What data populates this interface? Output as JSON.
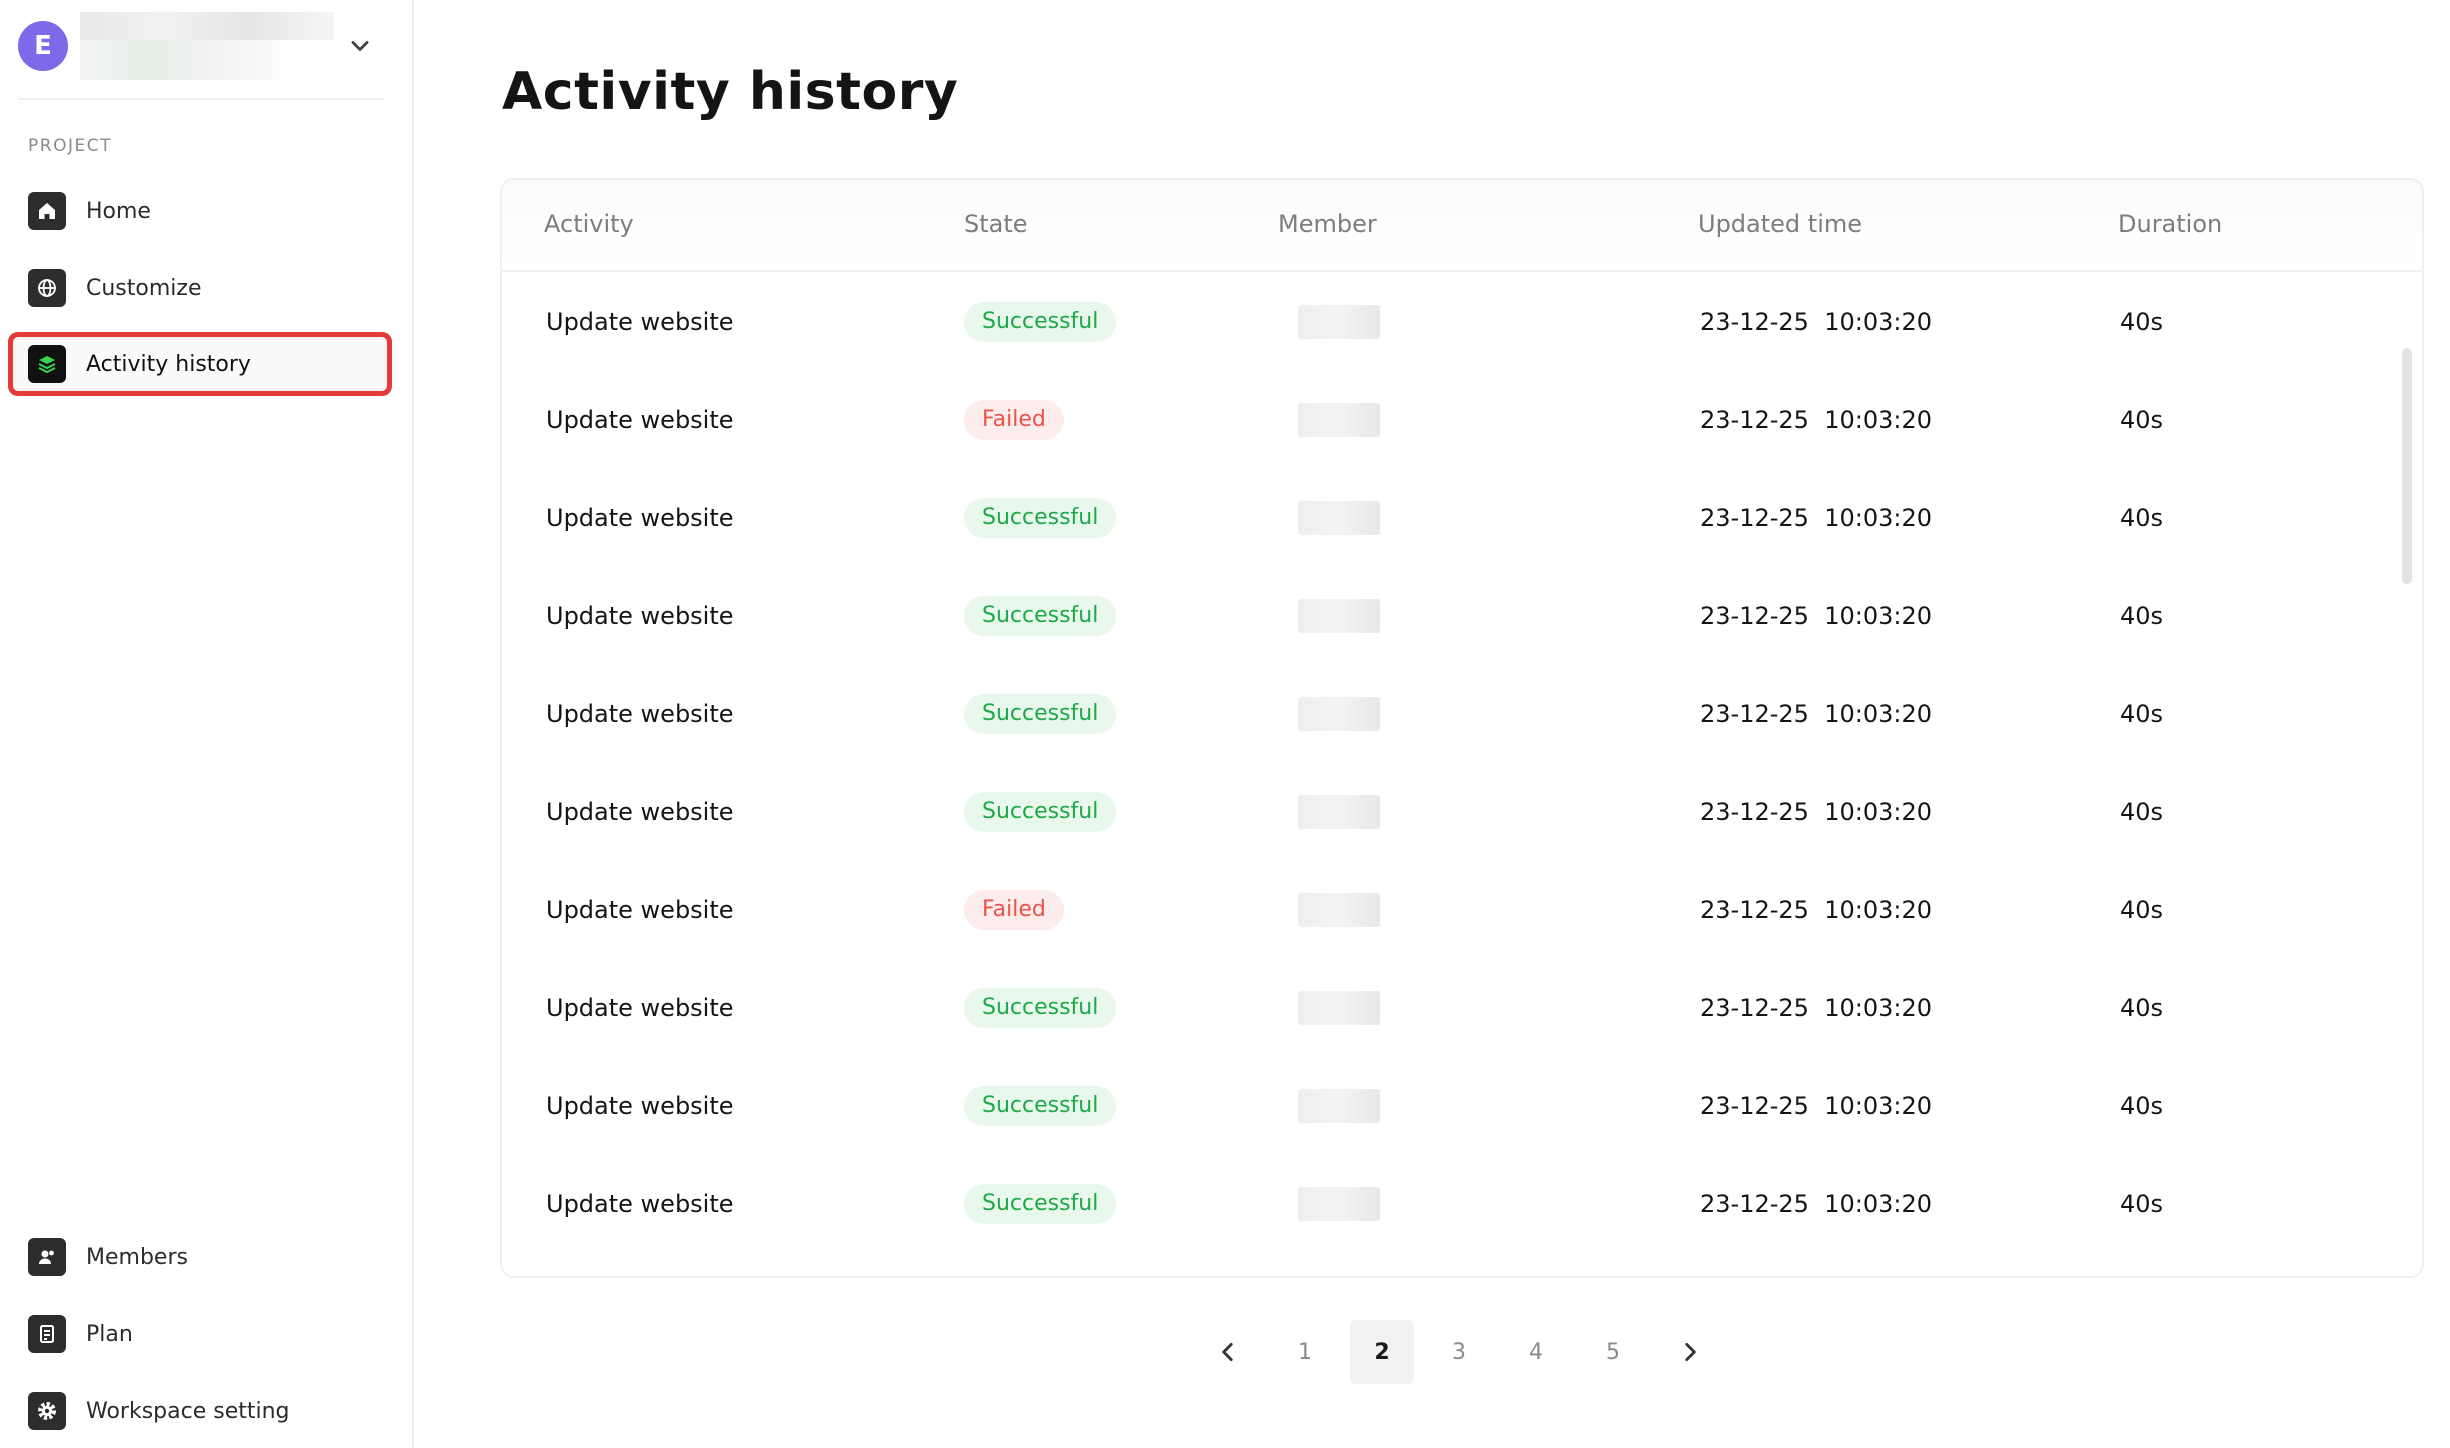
{
  "workspace": {
    "avatar_letter": "E"
  },
  "sidebar": {
    "section_label": "PROJECT",
    "items": [
      {
        "label": "Home",
        "icon": "home-icon"
      },
      {
        "label": "Customize",
        "icon": "globe-icon"
      },
      {
        "label": "Activity history",
        "icon": "layers-icon",
        "active": true
      }
    ],
    "bottom_items": [
      {
        "label": "Members",
        "icon": "members-icon"
      },
      {
        "label": "Plan",
        "icon": "plan-icon"
      },
      {
        "label": "Workspace setting",
        "icon": "gear-icon"
      }
    ]
  },
  "page": {
    "title": "Activity history"
  },
  "table": {
    "columns": [
      "Activity",
      "State",
      "Member",
      "Updated time",
      "Duration"
    ],
    "rows": [
      {
        "activity": "Update website",
        "state": "Successful",
        "status": "ok",
        "updated": "23-12-25  10:03:20",
        "duration": "40s"
      },
      {
        "activity": "Update website",
        "state": "Failed",
        "status": "fail",
        "updated": "23-12-25  10:03:20",
        "duration": "40s"
      },
      {
        "activity": "Update website",
        "state": "Successful",
        "status": "ok",
        "updated": "23-12-25  10:03:20",
        "duration": "40s"
      },
      {
        "activity": "Update website",
        "state": "Successful",
        "status": "ok",
        "updated": "23-12-25  10:03:20",
        "duration": "40s"
      },
      {
        "activity": "Update website",
        "state": "Successful",
        "status": "ok",
        "updated": "23-12-25  10:03:20",
        "duration": "40s"
      },
      {
        "activity": "Update website",
        "state": "Successful",
        "status": "ok",
        "updated": "23-12-25  10:03:20",
        "duration": "40s"
      },
      {
        "activity": "Update website",
        "state": "Failed",
        "status": "fail",
        "updated": "23-12-25  10:03:20",
        "duration": "40s"
      },
      {
        "activity": "Update website",
        "state": "Successful",
        "status": "ok",
        "updated": "23-12-25  10:03:20",
        "duration": "40s"
      },
      {
        "activity": "Update website",
        "state": "Successful",
        "status": "ok",
        "updated": "23-12-25  10:03:20",
        "duration": "40s"
      },
      {
        "activity": "Update website",
        "state": "Successful",
        "status": "ok",
        "updated": "23-12-25  10:03:20",
        "duration": "40s"
      }
    ]
  },
  "pagination": {
    "pages": [
      "1",
      "2",
      "3",
      "4",
      "5"
    ],
    "current": "2"
  },
  "colors": {
    "success_text": "#1ea84a",
    "success_bg": "#e9f8ec",
    "failed_text": "#e9534c",
    "failed_bg": "#fdecec",
    "avatar": "#7c6ae8",
    "highlight_outline": "#e5393a"
  }
}
